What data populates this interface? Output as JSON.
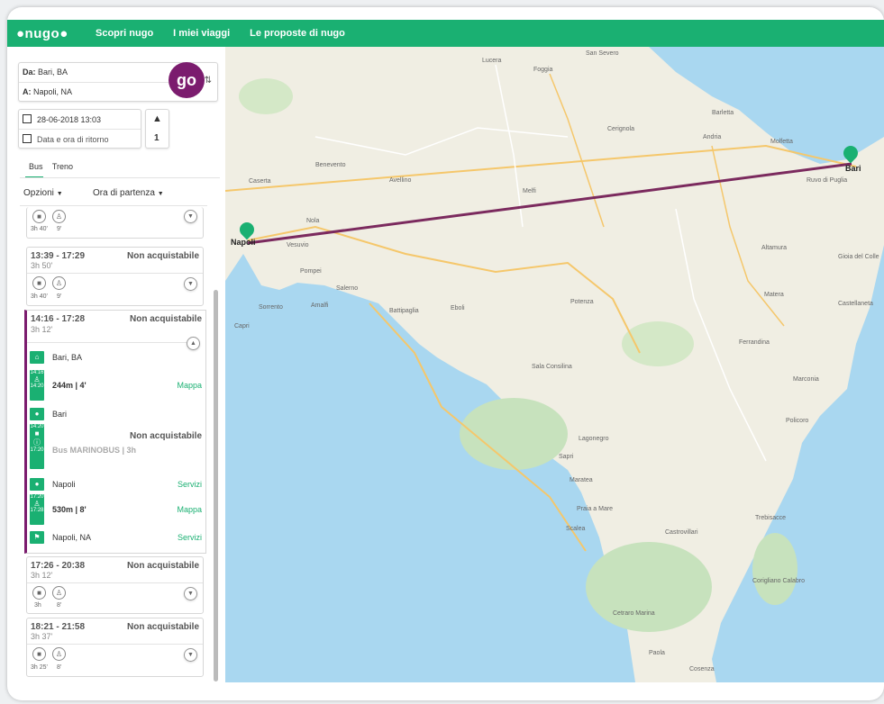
{
  "header": {
    "logo": "●nugo●",
    "nav": [
      "Scopri nugo",
      "I miei viaggi",
      "Le proposte di nugo"
    ]
  },
  "search": {
    "from_label": "Da:",
    "from_value": "Bari, BA",
    "to_label": "A:",
    "to_value": "Napoli, NA",
    "departure": "28-06-2018 13:03",
    "return_placeholder": "Data e ora di ritorno",
    "passengers": "1",
    "go_label": "go"
  },
  "tabs": [
    "Bus",
    "Treno"
  ],
  "filters": {
    "options_label": "Opzioni",
    "departure_label": "Ora di partenza"
  },
  "trips": [
    {
      "time": "",
      "status": "",
      "duration": "",
      "bus_time": "3h 40'",
      "walk_time": "9'"
    },
    {
      "time": "13:39 - 17:29",
      "status": "Non acquistabile",
      "duration": "3h 50'",
      "bus_time": "3h 40'",
      "walk_time": "9'"
    },
    {
      "time": "14:16 - 17:28",
      "status": "Non acquistabile",
      "duration": "3h 12'"
    },
    {
      "time": "17:26 - 20:38",
      "status": "Non acquistabile",
      "duration": "3h 12'",
      "bus_time": "3h",
      "walk_time": "8'"
    },
    {
      "time": "18:21 - 21:58",
      "status": "Non acquistabile",
      "duration": "3h 37'",
      "bus_time": "3h 25'",
      "walk_time": "8'"
    }
  ],
  "expanded": {
    "start": "Bari, BA",
    "walk1": {
      "t1": "14:16",
      "t2": "14:20",
      "text": "244m | 4'",
      "link": "Mappa"
    },
    "stop1": "Bari",
    "bus": {
      "t1": "14:20",
      "t2": "17:20",
      "status": "Non acquistabile",
      "line": "Bus MARINOBUS | 3h"
    },
    "stop2": "Napoli",
    "stop2_link": "Servizi",
    "walk2": {
      "t1": "17:20",
      "t2": "17:28",
      "text": "530m | 8'",
      "link": "Mappa"
    },
    "end": "Napoli, NA",
    "end_link": "Servizi"
  },
  "map": {
    "route_color": "#7b2a5e",
    "accent": "#1ab072",
    "cities": [
      "Napoli",
      "Bari"
    ],
    "places": [
      "Caserta",
      "Benevento",
      "Foggia",
      "Avellino",
      "Salerno",
      "Potenza",
      "Matera",
      "Altamura",
      "Barletta",
      "Andria",
      "Molfetta",
      "Lucera",
      "Cerignola",
      "Melfi",
      "Eboli",
      "Battipaglia",
      "Sala Consilina",
      "Lagonegro",
      "Sapri",
      "Maratea",
      "Praia a Mare",
      "Scalea",
      "Castrovillari",
      "Trebisacce",
      "Corigliano Calabro",
      "Cosenza",
      "Policoro",
      "Marconia",
      "Ferrandina",
      "Vesuvio",
      "Pompei",
      "Sorrento",
      "Amalfi",
      "Capri",
      "Nola",
      "San Severo",
      "Ruvo di Puglia",
      "Gioia del Colle",
      "Castellaneta",
      "Cetraro Marina",
      "Paola"
    ]
  }
}
